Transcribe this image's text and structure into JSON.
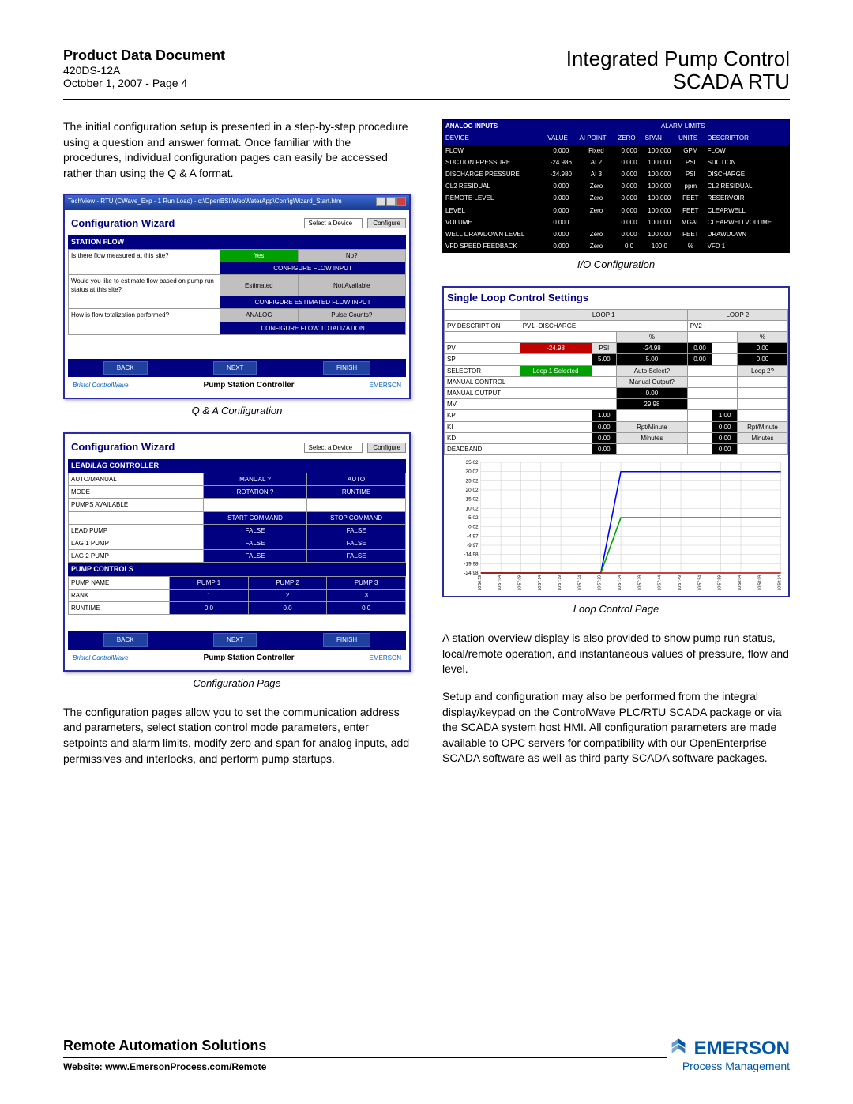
{
  "header": {
    "doc_title": "Product Data Document",
    "doc_id": "420DS-12A",
    "doc_date_page": "October 1, 2007 - Page 4",
    "product_line1": "Integrated Pump Control",
    "product_line2": "SCADA RTU"
  },
  "para1": "The initial configuration setup is presented in a step-by-step procedure using a question and answer format. Once familiar with the procedures, individual configuration pages can easily be accessed rather than using the Q & A format.",
  "para2": "The configuration pages allow you to set the communication address and parameters, select station control mode parameters, enter setpoints and alarm limits, modify zero and span for analog inputs, add permissives and interlocks, and perform pump startups.",
  "para3": "A station overview display is also provided to show pump run status, local/remote operation, and instantaneous values of pressure, flow and level.",
  "para4": "Setup and configuration may also be performed from the integral display/keypad on the ControlWave PLC/RTU SCADA package or via the SCADA system host HMI. All configuration parameters are made available to OPC servers for compatibility with our OpenEnterprise SCADA software as well as third party SCADA software packages.",
  "caption_qa": "Q & A Configuration",
  "caption_cfg": "Configuration Page",
  "caption_io": "I/O Configuration",
  "caption_loop": "Loop Control Page",
  "qa_panel": {
    "window_title": "TechView - RTU (CWave_Exp - 1 Run Load) - c:\\OpenBSI\\WebWaterApp\\ConfigWizard_Start.htm",
    "title": "Configuration Wizard",
    "select_label": "Select a Device",
    "configure_btn": "Configure",
    "section": "STATION FLOW",
    "q1": "Is there flow measured at this site?",
    "q1_yes": "Yes",
    "q1_no": "No?",
    "q1_action": "CONFIGURE FLOW INPUT",
    "q2": "Would you like to estimate flow based on pump run status at this site?",
    "q2_est": "Estimated",
    "q2_na": "Not Available",
    "q2_action": "CONFIGURE ESTIMATED FLOW INPUT",
    "q3": "How is flow totalization performed?",
    "q3_a": "ANALOG",
    "q3_b": "Pulse Counts?",
    "q3_action": "CONFIGURE FLOW TOTALIZATION",
    "nav_back": "BACK",
    "nav_next": "NEXT",
    "nav_finish": "FINISH",
    "footer_left": "Bristol ControlWave",
    "footer_mid": "Pump Station Controller",
    "footer_right": "EMERSON"
  },
  "cfg_panel": {
    "title": "Configuration Wizard",
    "select_label": "Select a Device",
    "configure_btn": "Configure",
    "section1": "LEAD/LAG CONTROLLER",
    "rows1": [
      [
        "AUTO/MANUAL",
        "MANUAL ?",
        "AUTO"
      ],
      [
        "MODE",
        "ROTATION ?",
        "RUNTIME"
      ],
      [
        "PUMPS AVAILABLE",
        "",
        ""
      ],
      [
        "",
        "START COMMAND",
        "STOP COMMAND"
      ],
      [
        "LEAD PUMP",
        "FALSE",
        "FALSE"
      ],
      [
        "LAG 1 PUMP",
        "FALSE",
        "FALSE"
      ],
      [
        "LAG 2 PUMP",
        "FALSE",
        "FALSE"
      ]
    ],
    "section2": "PUMP CONTROLS",
    "rows2": [
      [
        "PUMP NAME",
        "PUMP 1",
        "PUMP 2",
        "PUMP 3"
      ],
      [
        "RANK",
        "1",
        "2",
        "3"
      ],
      [
        "RUNTIME",
        "0.0",
        "0.0",
        "0.0"
      ]
    ],
    "nav_back": "BACK",
    "nav_next": "NEXT",
    "nav_finish": "FINISH",
    "footer_left": "Bristol ControlWave",
    "footer_mid": "Pump Station Controller",
    "footer_right": "EMERSON"
  },
  "io_table": {
    "title": "ANALOG INPUTS",
    "alarm_title": "ALARM LIMITS",
    "headers": [
      "DEVICE",
      "VALUE",
      "AI POINT",
      "ZERO",
      "SPAN",
      "UNITS",
      "DESCRIPTOR"
    ],
    "rows": [
      [
        "FLOW",
        "0.000",
        "Fixed",
        "0.000",
        "100.000",
        "GPM",
        "FLOW"
      ],
      [
        "SUCTION PRESSURE",
        "-24.986",
        "AI 2",
        "0.000",
        "100.000",
        "PSI",
        "SUCTION"
      ],
      [
        "DISCHARGE PRESSURE",
        "-24.980",
        "AI 3",
        "0.000",
        "100.000",
        "PSI",
        "DISCHARGE"
      ],
      [
        "CL2 RESIDUAL",
        "0.000",
        "Zero",
        "0.000",
        "100.000",
        "ppm",
        "CL2 RESIDUAL"
      ],
      [
        "REMOTE LEVEL",
        "0.000",
        "Zero",
        "0.000",
        "100.000",
        "FEET",
        "RESERVOIR"
      ],
      [
        "LEVEL",
        "0.000",
        "Zero",
        "0.000",
        "100.000",
        "FEET",
        "CLEARWELL"
      ],
      [
        "VOLUME",
        "0.000",
        "",
        "0.000",
        "100.000",
        "MGAL",
        "CLEARWELLVOLUME"
      ],
      [
        "WELL DRAWDOWN LEVEL",
        "0.000",
        "Zero",
        "0.000",
        "100.000",
        "FEET",
        "DRAWDOWN"
      ],
      [
        "VFD SPEED FEEDBACK",
        "0.000",
        "Zero",
        "0.0",
        "100.0",
        "%",
        "VFD 1"
      ]
    ]
  },
  "loop_panel": {
    "title": "Single Loop Control Settings",
    "loop1": "LOOP 1",
    "loop2": "LOOP 2",
    "pvdesc": "PV DESCRIPTION",
    "pv1": "PV1 -DISCHARGE",
    "pv2": "PV2 -",
    "pct": "%",
    "rows": [
      [
        "PV",
        "-24.98",
        "PSI",
        "-24.98",
        "0.00",
        "",
        "0.00"
      ],
      [
        "SP",
        "",
        "5.00",
        "5.00",
        "0.00",
        "",
        "0.00"
      ],
      [
        "SELECTOR",
        "Loop 1 Selected",
        "",
        "Auto Select?",
        "",
        "",
        "Loop 2?"
      ],
      [
        "MANUAL CONTROL",
        "",
        "",
        "Manual Output?",
        "",
        "",
        ""
      ],
      [
        "MANUAL OUTPUT",
        "",
        "",
        "0.00",
        "",
        "",
        ""
      ],
      [
        "MV",
        "",
        "",
        "29.98",
        "",
        "",
        ""
      ],
      [
        "KP",
        "",
        "1.00",
        "",
        "",
        "1.00",
        ""
      ],
      [
        "KI",
        "",
        "0.00",
        "Rpt/Minute",
        "",
        "0.00",
        "Rpt/Minute"
      ],
      [
        "KD",
        "",
        "0.00",
        "Minutes",
        "",
        "0.00",
        "Minutes"
      ],
      [
        "DEADBAND",
        "",
        "0.00",
        "",
        "",
        "0.00",
        ""
      ]
    ]
  },
  "chart_data": {
    "type": "line",
    "ylim": [
      -24.98,
      35.02
    ],
    "yticks": [
      35.02,
      30.02,
      25.02,
      20.02,
      15.02,
      10.02,
      5.02,
      0.02,
      -4.97,
      -9.97,
      -14.98,
      -19.98,
      -24.98
    ],
    "xticks": [
      "10:56:59",
      "10:57:04",
      "10:57:09",
      "10:57:14",
      "10:57:19",
      "10:57:24",
      "10:57:29",
      "10:57:34",
      "10:57:39",
      "10:57:44",
      "10:57:49",
      "10:57:54",
      "10:57:59",
      "10:58:04",
      "10:58:09",
      "10:58:14"
    ],
    "series": [
      {
        "name": "blue",
        "color": "#0000ff",
        "values": [
          -24.98,
          -24.98,
          -24.98,
          -24.98,
          -24.98,
          -24.98,
          -24.98,
          30,
          30,
          30,
          30,
          30,
          30,
          30,
          30,
          30
        ]
      },
      {
        "name": "green",
        "color": "#00a000",
        "values": [
          -24.98,
          -24.98,
          -24.98,
          -24.98,
          -24.98,
          -24.98,
          -24.98,
          5,
          5,
          5,
          5,
          5,
          5,
          5,
          5,
          5
        ]
      },
      {
        "name": "red",
        "color": "#c00000",
        "values": [
          -24.98,
          -24.98,
          -24.98,
          -24.98,
          -24.98,
          -24.98,
          -24.98,
          -24.98,
          -24.98,
          -24.98,
          -24.98,
          -24.98,
          -24.98,
          -24.98,
          -24.98,
          -24.98
        ]
      }
    ]
  },
  "footer": {
    "title": "Remote Automation Solutions",
    "website_label": "Website:  www.EmersonProcess.com/Remote",
    "brand": "EMERSON",
    "sub": "Process Management"
  }
}
